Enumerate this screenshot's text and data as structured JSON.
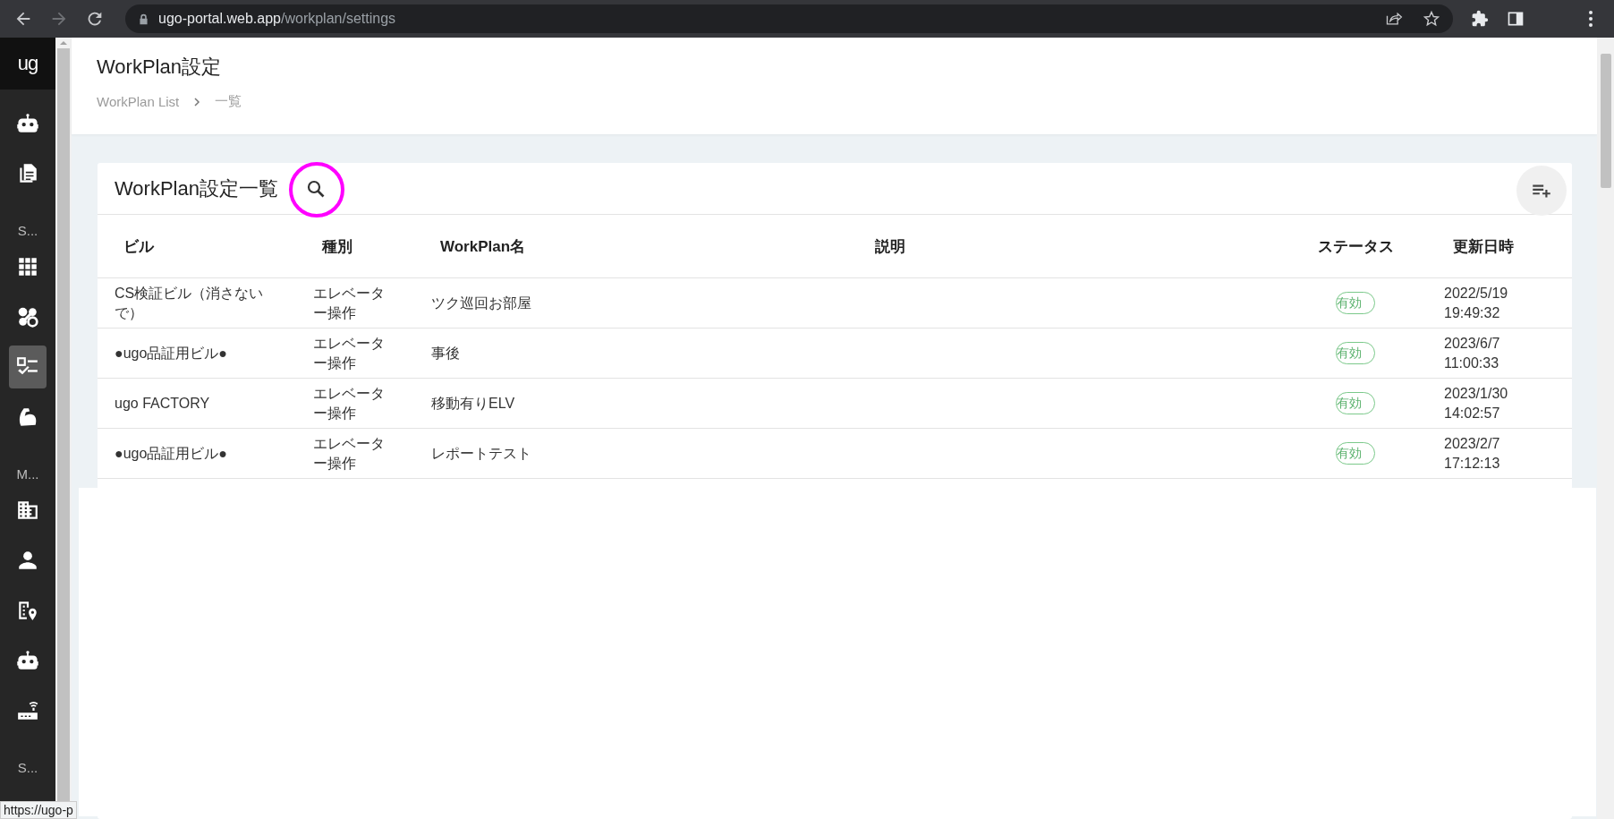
{
  "browser": {
    "url_host": "ugo-portal.web.app",
    "url_path": "/workplan/settings",
    "forward_disabled": true
  },
  "sidebar": {
    "logo": "ug",
    "items": [
      {
        "kind": "icon",
        "selected": false
      },
      {
        "kind": "icon",
        "selected": false
      },
      {
        "kind": "section",
        "label": "S..."
      },
      {
        "kind": "icon",
        "selected": false
      },
      {
        "kind": "icon",
        "selected": false
      },
      {
        "kind": "icon",
        "selected": true
      },
      {
        "kind": "icon",
        "selected": false
      },
      {
        "kind": "section",
        "label": "M..."
      },
      {
        "kind": "icon",
        "selected": false
      },
      {
        "kind": "icon",
        "selected": false
      },
      {
        "kind": "icon",
        "selected": false
      },
      {
        "kind": "icon",
        "selected": false
      },
      {
        "kind": "icon",
        "selected": false
      },
      {
        "kind": "section",
        "label": "S..."
      }
    ]
  },
  "page": {
    "title": "WorkPlan設定",
    "breadcrumb": [
      "WorkPlan List",
      "一覧"
    ]
  },
  "card": {
    "title": "WorkPlan設定一覧",
    "search": {
      "highlighted": true
    },
    "table": {
      "columns": [
        "ビル",
        "種別",
        "WorkPlan名",
        "説明",
        "ステータス",
        "更新日時"
      ],
      "rows": [
        {
          "building": "CS検証ビル（消さないで）",
          "type": "エレベーター操作",
          "name": "ツク巡回お部屋",
          "description": "",
          "status": "有効",
          "updated": "2022/5/19 19:49:32"
        },
        {
          "building": "●ugo品証用ビル●",
          "type": "エレベーター操作",
          "name": "事後",
          "description": "",
          "status": "有効",
          "updated": "2023/6/7 11:00:33"
        },
        {
          "building": "ugo FACTORY",
          "type": "エレベーター操作",
          "name": "移動有りELV",
          "description": "",
          "status": "有効",
          "updated": "2023/1/30 14:02:57"
        },
        {
          "building": "●ugo品証用ビル●",
          "type": "エレベーター操作",
          "name": "レポートテスト",
          "description": "",
          "status": "有効",
          "updated": "2023/2/7 17:12:13"
        }
      ]
    }
  },
  "status_url": "https://ugo-p"
}
